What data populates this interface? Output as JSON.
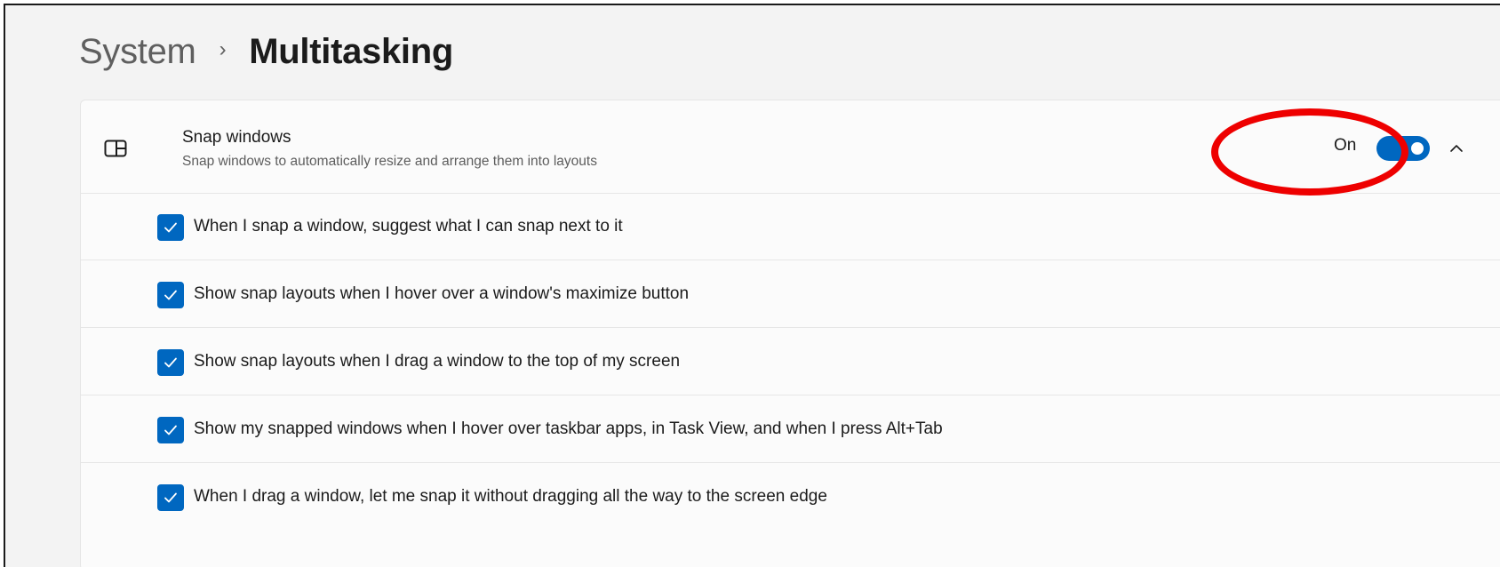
{
  "breadcrumb": {
    "parent": "System",
    "separator": "›",
    "current": "Multitasking"
  },
  "snap_windows": {
    "icon": "snap-layout-icon",
    "title": "Snap windows",
    "description": "Snap windows to automatically resize and arrange them into layouts",
    "toggle_state_label": "On",
    "toggle_on": true,
    "expanded": true,
    "accent_color": "#0067c0"
  },
  "options": [
    {
      "label": "When I snap a window, suggest what I can snap next to it",
      "checked": true
    },
    {
      "label": "Show snap layouts when I hover over a window's maximize button",
      "checked": true
    },
    {
      "label": "Show snap layouts when I drag a window to the top of my screen",
      "checked": true
    },
    {
      "label": "Show my snapped windows when I hover over taskbar apps, in Task View, and when I press Alt+Tab",
      "checked": true
    },
    {
      "label": "When I drag a window, let me snap it without dragging all the way to the screen edge",
      "checked": true
    }
  ],
  "annotation": {
    "shape": "ellipse",
    "color": "#ee0000",
    "target": "snap-windows-toggle"
  }
}
